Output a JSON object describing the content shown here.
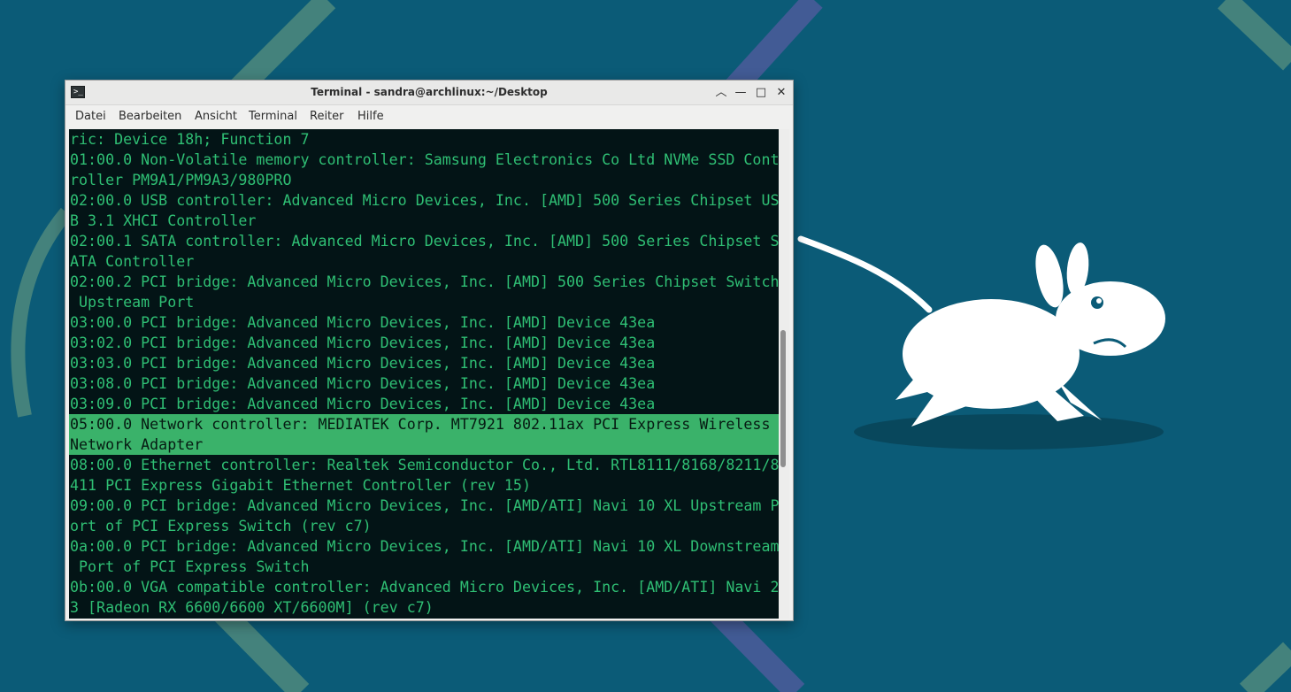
{
  "window": {
    "title": "Terminal - sandra@archlinux:~/Desktop",
    "app_icon_glyph": ">_",
    "buttons": {
      "shade_glyph": "︿",
      "minimize_glyph": "—",
      "maximize_glyph": "□",
      "close_glyph": "✕"
    }
  },
  "menubar": {
    "items": [
      "Datei",
      "Bearbeiten",
      "Ansicht",
      "Terminal",
      "Reiter",
      "Hilfe"
    ]
  },
  "terminal": {
    "lines": [
      "ric: Device 18h; Function 7",
      "01:00.0 Non-Volatile memory controller: Samsung Electronics Co Ltd NVMe SSD Cont",
      "roller PM9A1/PM9A3/980PRO",
      "02:00.0 USB controller: Advanced Micro Devices, Inc. [AMD] 500 Series Chipset US",
      "B 3.1 XHCI Controller",
      "02:00.1 SATA controller: Advanced Micro Devices, Inc. [AMD] 500 Series Chipset S",
      "ATA Controller",
      "02:00.2 PCI bridge: Advanced Micro Devices, Inc. [AMD] 500 Series Chipset Switch",
      " Upstream Port",
      "03:00.0 PCI bridge: Advanced Micro Devices, Inc. [AMD] Device 43ea",
      "03:02.0 PCI bridge: Advanced Micro Devices, Inc. [AMD] Device 43ea",
      "03:03.0 PCI bridge: Advanced Micro Devices, Inc. [AMD] Device 43ea",
      "03:08.0 PCI bridge: Advanced Micro Devices, Inc. [AMD] Device 43ea",
      "03:09.0 PCI bridge: Advanced Micro Devices, Inc. [AMD] Device 43ea",
      "05:00.0 Network controller: MEDIATEK Corp. MT7921 802.11ax PCI Express Wireless",
      "Network Adapter",
      "08:00.0 Ethernet controller: Realtek Semiconductor Co., Ltd. RTL8111/8168/8211/8",
      "411 PCI Express Gigabit Ethernet Controller (rev 15)",
      "09:00.0 PCI bridge: Advanced Micro Devices, Inc. [AMD/ATI] Navi 10 XL Upstream P",
      "ort of PCI Express Switch (rev c7)",
      "0a:00.0 PCI bridge: Advanced Micro Devices, Inc. [AMD/ATI] Navi 10 XL Downstream",
      " Port of PCI Express Switch",
      "0b:00.0 VGA compatible controller: Advanced Micro Devices, Inc. [AMD/ATI] Navi 2",
      "3 [Radeon RX 6600/6600 XT/6600M] (rev c7)"
    ],
    "highlighted_lines": [
      14,
      15
    ],
    "colors": {
      "background": "#031416",
      "foreground": "#2fbf74",
      "highlight_background": "#3ab26a",
      "highlight_foreground": "#061a12"
    }
  },
  "scrollbar": {
    "position_fraction": 0.57,
    "visible_fraction": 0.28
  },
  "desktop": {
    "background_color": "#0b5b77",
    "wallpaper_icon": "xfce-mouse-icon"
  }
}
